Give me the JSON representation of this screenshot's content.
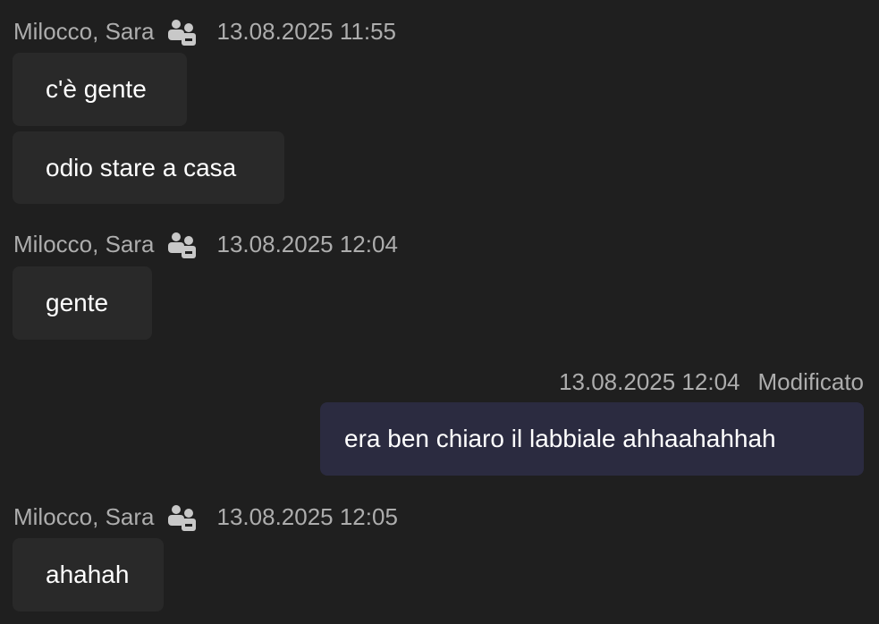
{
  "messages": [
    {
      "sender": "Milocco, Sara",
      "timestamp": "13.08.2025 11:55",
      "bubbles": [
        "c'è gente",
        "odio stare a casa"
      ]
    },
    {
      "sender": "Milocco, Sara",
      "timestamp": "13.08.2025 12:04",
      "bubbles": [
        "gente"
      ]
    },
    {
      "sender": "",
      "timestamp": "13.08.2025 12:04",
      "edited_label": "Modificato",
      "bubbles": [
        "era ben chiaro il labbiale ahhaahahhah"
      ],
      "own": true
    },
    {
      "sender": "Milocco, Sara",
      "timestamp": "13.08.2025 12:05",
      "bubbles": [
        "ahahah"
      ]
    }
  ],
  "colors": {
    "background": "#1f1f1f",
    "incoming_bubble": "#292929",
    "outgoing_bubble": "#2b2b40",
    "meta_text": "#adadad"
  },
  "icons": {
    "sender_status": "org-people-icon"
  }
}
